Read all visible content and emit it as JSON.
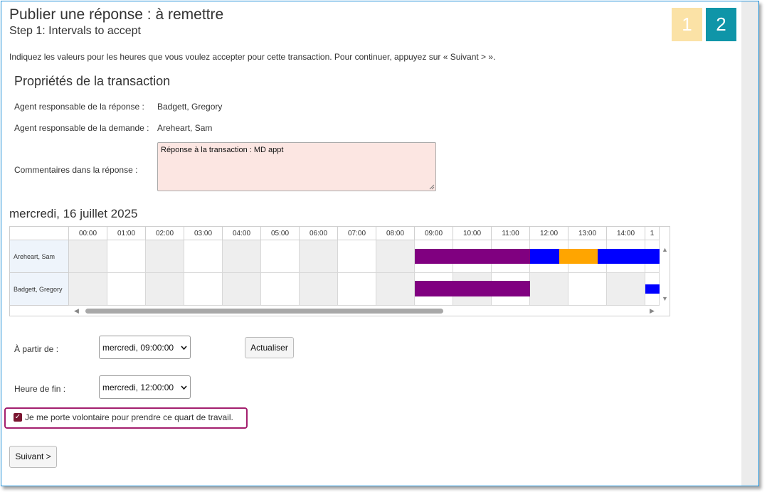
{
  "header": {
    "title": "Publier une réponse : à remettre",
    "subtitle": "Step 1: Intervals to accept",
    "steps": [
      "1",
      "2"
    ]
  },
  "intro": "Indiquez les valeurs pour les heures que vous voulez accepter pour cette transaction. Pour continuer, appuyez sur « Suivant > ».",
  "properties": {
    "heading": "Propriétés de la transaction",
    "responder_label": "Agent responsable de la réponse :",
    "responder_value": "Badgett, Gregory",
    "requester_label": "Agent responsable de la demande :",
    "requester_value": "Areheart, Sam",
    "comments_label": "Commentaires dans la réponse :",
    "comments_value": "Réponse à la transaction : MD appt"
  },
  "schedule": {
    "date": "mercredi, 16 juillet 2025",
    "hours": [
      "00:00",
      "01:00",
      "02:00",
      "03:00",
      "04:00",
      "05:00",
      "06:00",
      "07:00",
      "08:00",
      "09:00",
      "10:00",
      "11:00",
      "12:00",
      "13:00",
      "14:00",
      "1"
    ],
    "agents": [
      "Areheart, Sam",
      "Badgett, Gregory"
    ],
    "colors": {
      "purple": "#800080",
      "blue": "#0000ff",
      "orange": "#ffa500",
      "grey": "#eeeeee"
    }
  },
  "form": {
    "start_label": "À partir de :",
    "start_value": "mercredi, 09:00:00",
    "end_label": "Heure de fin :",
    "end_value": "mercredi, 12:00:00",
    "refresh_button": "Actualiser",
    "volunteer_label": "Je me porte volontaire pour prendre ce quart de travail.",
    "next_button": "Suivant >"
  }
}
